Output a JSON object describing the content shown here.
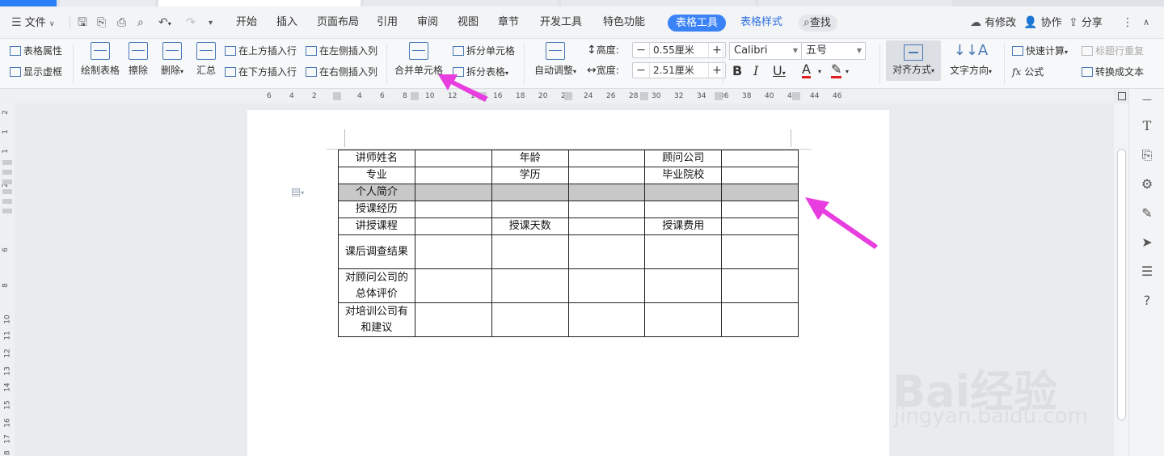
{
  "menubar": {
    "file": "文件",
    "tabs": [
      "开始",
      "插入",
      "页面布局",
      "引用",
      "审阅",
      "视图",
      "章节",
      "开发工具",
      "特色功能"
    ],
    "active_tab": "表格工具",
    "table_style_tab": "表格样式",
    "search": "查找",
    "modified": "有修改",
    "collab": "协作",
    "share": "分享"
  },
  "ribbon": {
    "table_props": "表格属性",
    "show_grid": "显示虚框",
    "draw_table": "绘制表格",
    "erase": "擦除",
    "delete": "删除",
    "summary": "汇总",
    "insert_above": "在上方插入行",
    "insert_below": "在下方插入行",
    "insert_left": "在左侧插入列",
    "insert_right": "在右侧插入列",
    "merge_cells": "合并单元格",
    "split_cells": "拆分单元格",
    "split_table": "拆分表格",
    "auto_fit": "自动调整",
    "height_label": "高度:",
    "height_value": "0.55厘米",
    "width_label": "宽度:",
    "width_value": "2.51厘米",
    "font_name": "Calibri",
    "font_size": "五号",
    "align": "对齐方式",
    "text_dir": "文字方向",
    "quick_calc": "快速计算",
    "repeat_header": "标题行重复",
    "formula": "公式",
    "to_text": "转换成文本"
  },
  "ruler": {
    "labels": [
      "6",
      "4",
      "2",
      "2",
      "4",
      "6",
      "8",
      "10",
      "12",
      "14",
      "16",
      "18",
      "20",
      "22",
      "24",
      "26",
      "28",
      "30",
      "32",
      "34",
      "36",
      "38",
      "40",
      "42",
      "44",
      "46"
    ]
  },
  "vruler": {
    "labels": [
      "2",
      "1",
      "1",
      "2",
      "6",
      "8",
      "10",
      "11",
      "12",
      "13",
      "14",
      "15",
      "16",
      "17",
      "18"
    ]
  },
  "table": {
    "rows": [
      [
        "讲师姓名",
        "",
        "年龄",
        "",
        "顾问公司",
        ""
      ],
      [
        "专业",
        "",
        "学历",
        "",
        "毕业院校",
        ""
      ],
      [
        "个人简介",
        "",
        "",
        "",
        "",
        ""
      ],
      [
        "授课经历",
        "",
        "",
        "",
        "",
        ""
      ],
      [
        "讲授课程",
        "",
        "授课天数",
        "",
        "授课费用",
        ""
      ],
      [
        "课后调查结果",
        "",
        "",
        "",
        "",
        ""
      ],
      [
        "对顾问公司的总体评价",
        "",
        "",
        "",
        "",
        ""
      ],
      [
        "对培训公司有和建议",
        "",
        "",
        "",
        "",
        ""
      ]
    ]
  },
  "watermark": {
    "brand": "Bai经验",
    "url": "jingyan.baidu.com"
  },
  "colors": {
    "accent": "#3b82f6",
    "arrow": "#e83ee0",
    "selected_row": "#c8c8c8"
  }
}
